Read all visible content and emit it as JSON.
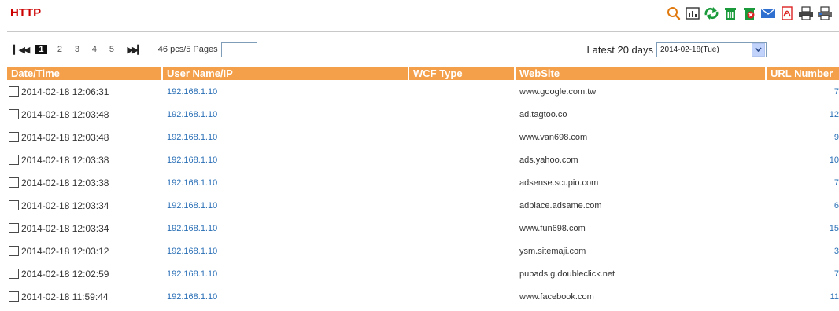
{
  "title": "HTTP",
  "toolbar": {
    "icons": [
      "search-icon",
      "chart-icon",
      "refresh-icon",
      "delete-icon",
      "delete-all-icon",
      "email-icon",
      "pdf-icon",
      "print-icon",
      "print-all-icon"
    ]
  },
  "pager": {
    "first_glyph": "▎◀◀",
    "next_glyph": "▶▶▎",
    "pages": [
      "1",
      "2",
      "3",
      "4",
      "5"
    ],
    "current_page": "1",
    "summary": "46 pcs/5 Pages",
    "jump_value": ""
  },
  "range": {
    "label": "Latest 20 days",
    "selected": "2014-02-18(Tue)"
  },
  "table": {
    "columns": [
      "Date/Time",
      "User Name/IP",
      "WCF Type",
      "WebSite",
      "URL Number"
    ],
    "rows": [
      {
        "datetime": "2014-02-18 12:06:31",
        "user": "192.168.1.10",
        "wcf": "",
        "website": "www.google.com.tw",
        "url_number": "7"
      },
      {
        "datetime": "2014-02-18 12:03:48",
        "user": "192.168.1.10",
        "wcf": "",
        "website": "ad.tagtoo.co",
        "url_number": "12"
      },
      {
        "datetime": "2014-02-18 12:03:48",
        "user": "192.168.1.10",
        "wcf": "",
        "website": "www.van698.com",
        "url_number": "9"
      },
      {
        "datetime": "2014-02-18 12:03:38",
        "user": "192.168.1.10",
        "wcf": "",
        "website": "ads.yahoo.com",
        "url_number": "10"
      },
      {
        "datetime": "2014-02-18 12:03:38",
        "user": "192.168.1.10",
        "wcf": "",
        "website": "adsense.scupio.com",
        "url_number": "7"
      },
      {
        "datetime": "2014-02-18 12:03:34",
        "user": "192.168.1.10",
        "wcf": "",
        "website": "adplace.adsame.com",
        "url_number": "6"
      },
      {
        "datetime": "2014-02-18 12:03:34",
        "user": "192.168.1.10",
        "wcf": "",
        "website": "www.fun698.com",
        "url_number": "15"
      },
      {
        "datetime": "2014-02-18 12:03:12",
        "user": "192.168.1.10",
        "wcf": "",
        "website": "ysm.sitemaji.com",
        "url_number": "3"
      },
      {
        "datetime": "2014-02-18 12:02:59",
        "user": "192.168.1.10",
        "wcf": "",
        "website": "pubads.g.doubleclick.net",
        "url_number": "7"
      },
      {
        "datetime": "2014-02-18 11:59:44",
        "user": "192.168.1.10",
        "wcf": "",
        "website": "www.facebook.com",
        "url_number": "11"
      }
    ]
  },
  "colors": {
    "title": "#cc0000",
    "header_bg": "#f4a04a",
    "link": "#2a6fb6"
  }
}
